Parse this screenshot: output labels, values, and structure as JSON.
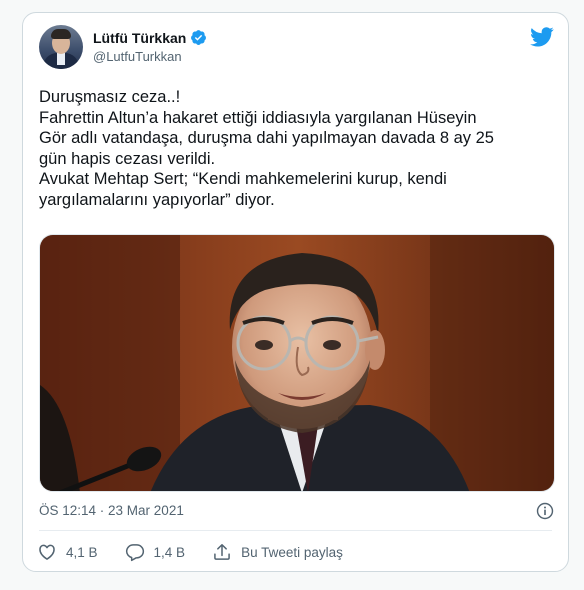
{
  "user": {
    "display_name": "Lütfü Türkkan",
    "handle": "@LutfuTurkkan",
    "verified": true
  },
  "tweet": {
    "lines": [
      "Duruşmasız ceza..!",
      "Fahrettin Altun’a hakaret ettiği iddiasıyla yargılanan Hüseyin",
      "Gör adlı vatandaşa, duruşma dahi yapılmayan davada 8 ay 25",
      "gün hapis cezası verildi.",
      "Avukat Mehtap Sert; “Kendi mahkemelerini kurup, kendi",
      "yargılamalarını yapıyorlar” diyor."
    ],
    "timestamp": "ÖS 12:14 · 23 Mar 2021"
  },
  "actions": {
    "likes": "4,1 B",
    "replies": "1,4 B",
    "share_label": "Bu Tweeti paylaş"
  },
  "colors": {
    "brand": "#1d9bf0",
    "text_primary": "#0f1419",
    "text_secondary": "#536471",
    "border": "#cfd9de",
    "background": "#f7f9f9"
  },
  "icons": [
    "verified-badge-icon",
    "twitter-bird-icon",
    "info-icon",
    "heart-icon",
    "reply-icon",
    "share-icon"
  ]
}
